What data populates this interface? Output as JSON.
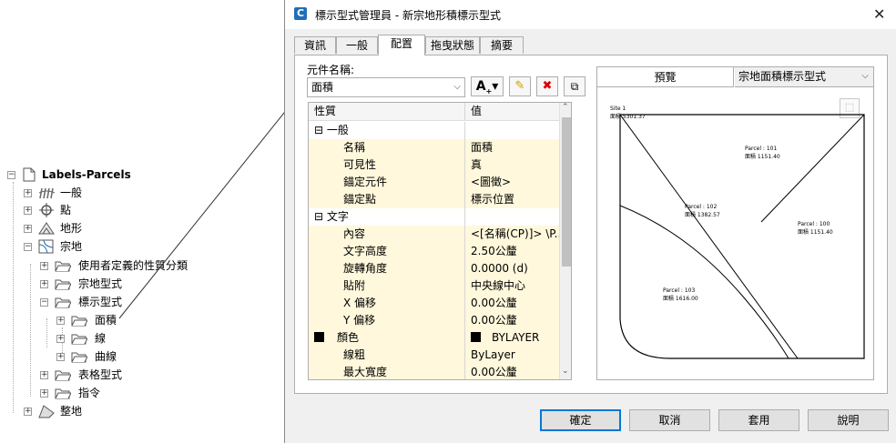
{
  "tree": {
    "root": "Labels-Parcels",
    "items": [
      {
        "label": "一般",
        "icon": "general-icon"
      },
      {
        "label": "點",
        "icon": "point-icon"
      },
      {
        "label": "地形",
        "icon": "surface-icon"
      },
      {
        "label": "宗地",
        "icon": "parcel-icon"
      },
      {
        "label": "使用者定義的性質分類",
        "icon": "folder-icon"
      },
      {
        "label": "宗地型式",
        "icon": "folder-icon"
      },
      {
        "label": "標示型式",
        "icon": "folder-icon"
      },
      {
        "label": "面積",
        "icon": "folder-icon"
      },
      {
        "label": "線",
        "icon": "folder-icon"
      },
      {
        "label": "曲線",
        "icon": "folder-icon"
      },
      {
        "label": "表格型式",
        "icon": "folder-icon"
      },
      {
        "label": "指令",
        "icon": "folder-icon"
      },
      {
        "label": "整地",
        "icon": "grading-icon"
      }
    ]
  },
  "dialog": {
    "title": "標示型式管理員 - 新宗地形積標示型式",
    "tabs": [
      "資訊",
      "一般",
      "配置",
      "拖曳狀態",
      "摘要"
    ],
    "active_tab": "配置",
    "component_label": "元件名稱:",
    "component_value": "面積",
    "grid_headers": {
      "property": "性質",
      "value": "值"
    },
    "rows": [
      {
        "type": "category",
        "name": "一般",
        "toggle": "⊟"
      },
      {
        "type": "prop",
        "name": "名稱",
        "value": "面積"
      },
      {
        "type": "prop",
        "name": "可見性",
        "value": "真"
      },
      {
        "type": "prop",
        "name": "錨定元件",
        "value": "<圖徵>"
      },
      {
        "type": "prop",
        "name": "錨定點",
        "value": "標示位置"
      },
      {
        "type": "category",
        "name": "文字",
        "toggle": "⊟"
      },
      {
        "type": "prop",
        "name": "內容",
        "value": "<[名稱(CP)]> \\P..."
      },
      {
        "type": "prop",
        "name": "文字高度",
        "value": "2.50公釐"
      },
      {
        "type": "prop",
        "name": "旋轉角度",
        "value": "0.0000 (d)"
      },
      {
        "type": "prop",
        "name": "貼附",
        "value": "中央線中心"
      },
      {
        "type": "prop",
        "name": "X 偏移",
        "value": "0.00公釐"
      },
      {
        "type": "prop",
        "name": "Y 偏移",
        "value": "0.00公釐"
      },
      {
        "type": "color",
        "name": "顏色",
        "value": "BYLAYER"
      },
      {
        "type": "prop",
        "name": "線粗",
        "value": "ByLayer"
      },
      {
        "type": "prop",
        "name": "最大寬度",
        "value": "0.00公釐"
      }
    ],
    "preview_label": "預覽",
    "preview_style": "宗地面積標示型式",
    "preview_labels": {
      "site": "Site 1",
      "site_area": "面積 5301.37",
      "p101_name": "Parcel : 101",
      "p101_area": "面積 1151.40",
      "p102_name": "Parcel : 102",
      "p102_area": "面積 1382.57",
      "p100_name": "Parcel : 100",
      "p100_area": "面積 1151.40",
      "p103_name": "Parcel : 103",
      "p103_area": "面積 1616.00"
    },
    "buttons": {
      "ok": "確定",
      "cancel": "取消",
      "apply": "套用",
      "help": "說明"
    }
  }
}
